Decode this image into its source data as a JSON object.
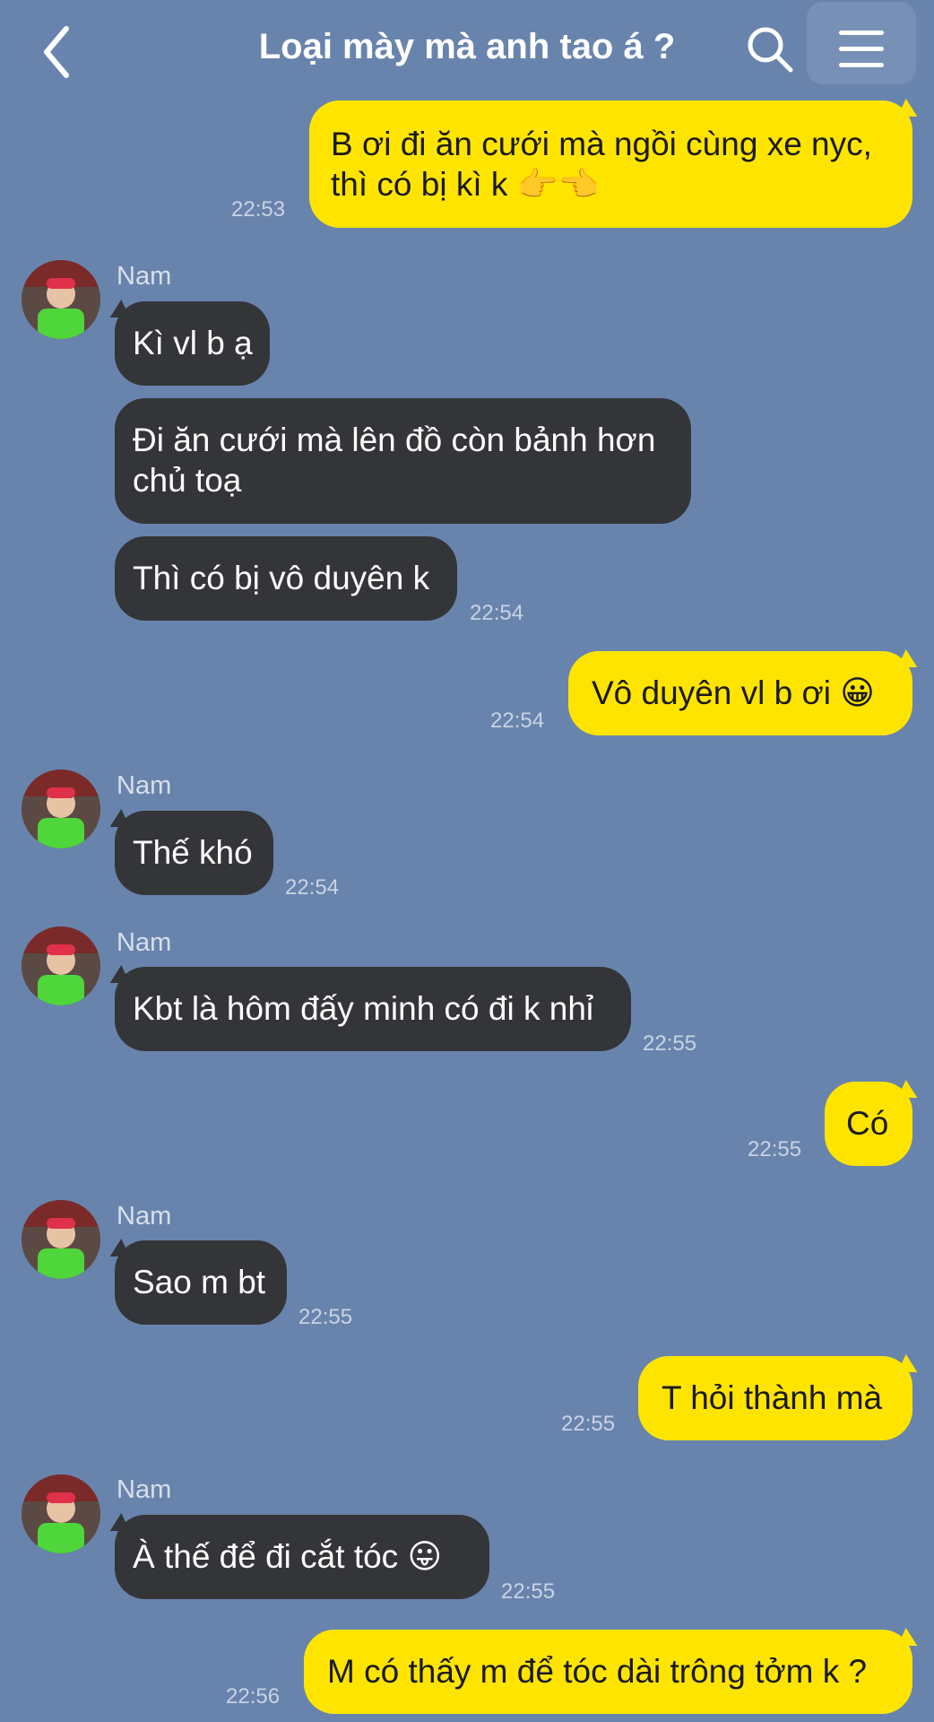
{
  "header": {
    "title": "Loại mày mà anh tao á ?"
  },
  "messages": [
    {
      "text_1": "B ơi đi ăn cưới mà ngồi cùng xe nyc,",
      "text_2": "thì có bị kì k 👉👈",
      "time": "22:53"
    },
    {
      "sender": "Nam",
      "text": "Kì vl b ạ"
    },
    {
      "text_1": "Đi ăn cưới mà lên đồ còn bảnh hơn",
      "text_2": "chủ toạ"
    },
    {
      "text": "Thì có bị vô duyên k",
      "time": "22:54"
    },
    {
      "text": "Vô duyên vl b ơi 😀",
      "time": "22:54"
    },
    {
      "sender": "Nam",
      "text": "Thế khó",
      "time": "22:54"
    },
    {
      "sender": "Nam",
      "text": "Kbt là hôm đấy minh có đi k nhỉ",
      "time": "22:55"
    },
    {
      "text": "Có",
      "time": "22:55"
    },
    {
      "sender": "Nam",
      "text": "Sao m bt",
      "time": "22:55"
    },
    {
      "text": "T hỏi thành mà",
      "time": "22:55"
    },
    {
      "sender": "Nam",
      "text": "À thế để đi cắt tóc 😛",
      "time": "22:55"
    },
    {
      "text": "M có thấy m để tóc dài trông tởm k ?",
      "time": "22:56"
    }
  ],
  "colors": {
    "background": "#6884ad",
    "outgoing_bubble": "#ffe400",
    "incoming_bubble": "#343538"
  },
  "icons": [
    "back-arrow-icon",
    "search-icon",
    "menu-icon"
  ]
}
